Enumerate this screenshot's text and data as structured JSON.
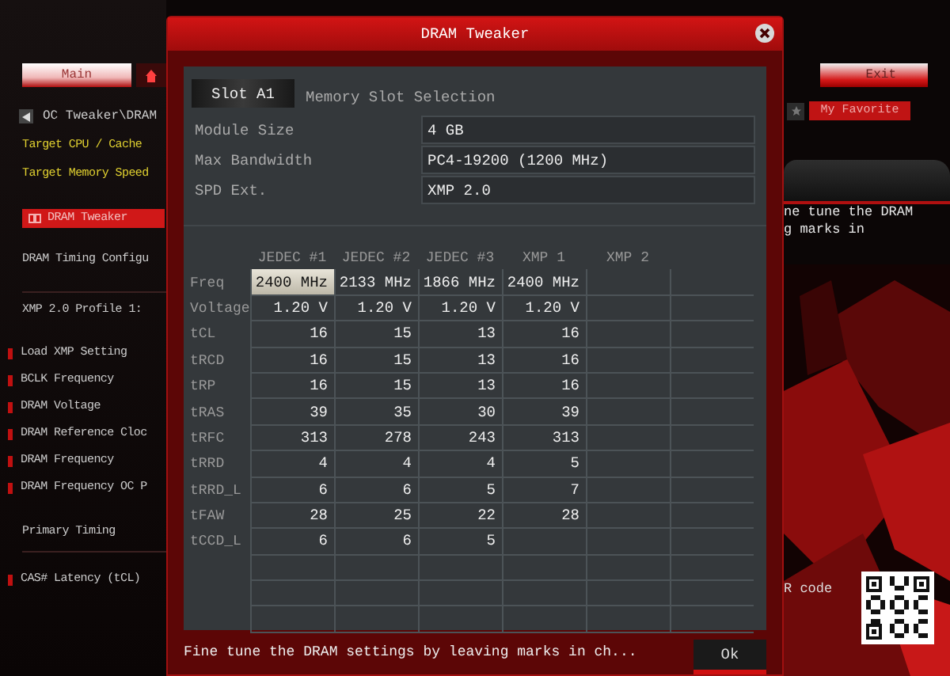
{
  "top_tabs": [
    {
      "label": "Main",
      "selected": true
    },
    {
      "selected": false
    }
  ],
  "sidebar": {
    "path": "OC Tweaker\\DRAM",
    "items": [
      {
        "text": "Target CPU / Cache",
        "kind": "target"
      },
      {
        "text": "Target Memory Speed",
        "kind": "target"
      },
      {
        "text": "DRAM Tweaker",
        "kind": "page",
        "selected": true
      },
      {
        "text": "DRAM Timing Configu",
        "kind": "page",
        "selected": false
      },
      {
        "text": "XMP 2.0 Profile 1: ",
        "kind": "info"
      },
      {
        "text": "Load XMP Setting",
        "kind": "setting"
      },
      {
        "text": "BCLK Frequency",
        "kind": "setting"
      },
      {
        "text": "DRAM Voltage",
        "kind": "setting"
      },
      {
        "text": "DRAM Reference Cloc",
        "kind": "setting"
      },
      {
        "text": "DRAM Frequency",
        "kind": "setting"
      },
      {
        "text": "DRAM Frequency OC P",
        "kind": "setting"
      },
      {
        "text": "Primary Timing",
        "kind": "heading"
      },
      {
        "text": "CAS# Latency (tCL)",
        "kind": "setting"
      }
    ]
  },
  "right": {
    "exit_button": "Exit",
    "favorite_button": "My Favorite",
    "help_lines": [
      "ne tune the DRAM",
      "g marks in"
    ],
    "qr_label": "R code"
  },
  "dialog": {
    "title": "DRAM Tweaker",
    "slot_button": "Slot A1",
    "slot_label": "Memory Slot Selection",
    "fields": [
      {
        "label": "Module Size",
        "value": "4 GB"
      },
      {
        "label": "Max Bandwidth",
        "value": "PC4-19200 (1200 MHz)"
      },
      {
        "label": "SPD Ext.",
        "value": "XMP 2.0"
      }
    ],
    "table": {
      "columns": [
        "JEDEC #1",
        "JEDEC #2",
        "JEDEC #3",
        "XMP 1",
        "XMP 2"
      ],
      "rows": [
        {
          "label": "Freq",
          "cells": [
            {
              "text": "2400 MHz",
              "selected": true
            },
            {
              "text": "2133 MHz",
              "selected": false
            },
            {
              "text": "1866 MHz",
              "selected": false
            },
            {
              "text": "2400 MHz",
              "selected": false
            }
          ]
        },
        {
          "label": "Voltage",
          "cells": [
            {
              "text": "1.20 V",
              "selected": false
            },
            {
              "text": "1.20 V",
              "selected": false
            },
            {
              "text": "1.20 V",
              "selected": false
            },
            {
              "text": "1.20 V",
              "selected": false
            }
          ]
        },
        {
          "label": "tCL",
          "cells": [
            {
              "text": "16",
              "selected": false
            },
            {
              "text": "15",
              "selected": false
            },
            {
              "text": "13",
              "selected": false
            },
            {
              "text": "16",
              "selected": false
            }
          ]
        },
        {
          "label": "tRCD",
          "cells": [
            {
              "text": "16",
              "selected": false
            },
            {
              "text": "15",
              "selected": false
            },
            {
              "text": "13",
              "selected": false
            },
            {
              "text": "16",
              "selected": false
            }
          ]
        },
        {
          "label": "tRP",
          "cells": [
            {
              "text": "16",
              "selected": false
            },
            {
              "text": "15",
              "selected": false
            },
            {
              "text": "13",
              "selected": false
            },
            {
              "text": "16",
              "selected": false
            }
          ]
        },
        {
          "label": "tRAS",
          "cells": [
            {
              "text": "39",
              "selected": false
            },
            {
              "text": "35",
              "selected": false
            },
            {
              "text": "30",
              "selected": false
            },
            {
              "text": "39",
              "selected": false
            }
          ]
        },
        {
          "label": "tRFC",
          "cells": [
            {
              "text": "313",
              "selected": false
            },
            {
              "text": "278",
              "selected": false
            },
            {
              "text": "243",
              "selected": false
            },
            {
              "text": "313",
              "selected": false
            }
          ]
        },
        {
          "label": "tRRD",
          "cells": [
            {
              "text": "4",
              "selected": false
            },
            {
              "text": "4",
              "selected": false
            },
            {
              "text": "4",
              "selected": false
            },
            {
              "text": "5",
              "selected": false
            }
          ]
        },
        {
          "label": "tRRD_L",
          "cells": [
            {
              "text": "6",
              "selected": false
            },
            {
              "text": "6",
              "selected": false
            },
            {
              "text": "5",
              "selected": false
            },
            {
              "text": "7",
              "selected": false
            }
          ]
        },
        {
          "label": "tFAW",
          "cells": [
            {
              "text": "28",
              "selected": false
            },
            {
              "text": "25",
              "selected": false
            },
            {
              "text": "22",
              "selected": false
            },
            {
              "text": "28",
              "selected": false
            }
          ]
        },
        {
          "label": "tCCD_L",
          "cells": [
            {
              "text": "6",
              "selected": false
            },
            {
              "text": "6",
              "selected": false
            },
            {
              "text": "5",
              "selected": false
            }
          ]
        }
      ]
    },
    "footer_text": "Fine tune the DRAM settings by leaving marks in ch...",
    "ok_button": "Ok"
  }
}
